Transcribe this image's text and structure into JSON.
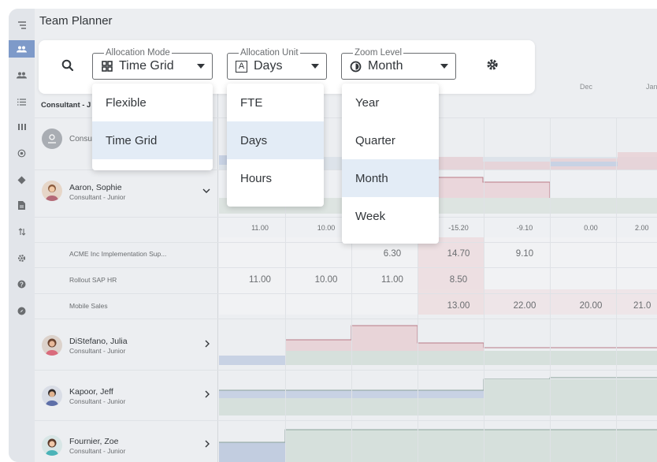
{
  "app": {
    "title": "Team Planner"
  },
  "toolbar": {
    "allocation_mode": {
      "legend": "Allocation Mode",
      "value": "Time Grid"
    },
    "allocation_unit": {
      "legend": "Allocation Unit",
      "value": "Days",
      "icon_letter": "A"
    },
    "zoom_level": {
      "legend": "Zoom Level",
      "value": "Month"
    }
  },
  "menus": {
    "allocation_mode": {
      "items": [
        "Flexible",
        "Time Grid"
      ],
      "selected": "Time Grid"
    },
    "allocation_unit": {
      "items": [
        "FTE",
        "Days",
        "Hours"
      ],
      "selected": "Days"
    },
    "zoom_level": {
      "items": [
        "Year",
        "Quarter",
        "Month",
        "Week"
      ],
      "selected": "Month"
    }
  },
  "grid": {
    "column_header": "Consultant - J",
    "month_headers": [
      "Dec",
      "Jan"
    ],
    "people": [
      {
        "name": "Consu",
        "role": ""
      },
      {
        "name": "Aaron, Sophie",
        "role": "Consultant - Junior"
      },
      {
        "name": "DiStefano, Julia",
        "role": "Consultant - Junior"
      },
      {
        "name": "Kapoor, Jeff",
        "role": "Consultant - Junior"
      },
      {
        "name": "Fournier, Zoe",
        "role": "Consultant - Junior"
      }
    ],
    "summary_row": [
      "11.00",
      "10.00",
      "",
      "-15.20",
      "-9.10",
      "0.00",
      "2.00"
    ],
    "sub_rows": [
      {
        "label": "ACME Inc Implementation Sup...",
        "values": [
          "",
          "",
          "6.30",
          "14.70",
          "9.10",
          "",
          ""
        ]
      },
      {
        "label": "Rollout SAP HR",
        "values": [
          "11.00",
          "10.00",
          "11.00",
          "8.50",
          "",
          "",
          ""
        ]
      },
      {
        "label": "Mobile Sales",
        "values": [
          "",
          "",
          "",
          "13.00",
          "22.00",
          "20.00",
          "21.0"
        ]
      }
    ]
  },
  "colors": {
    "accent": "#7e9ac9",
    "over_allocation": "#e8cfd4",
    "capacity": "#d6e0dc",
    "selected_item": "#e3ecf6"
  }
}
